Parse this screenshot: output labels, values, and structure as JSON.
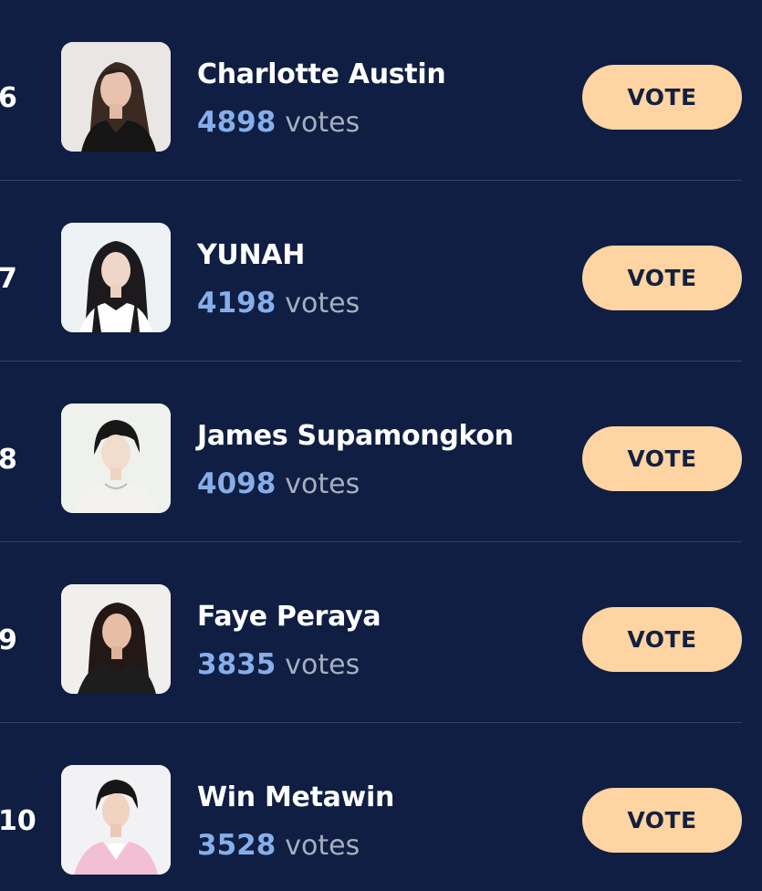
{
  "leaderboard": {
    "vote_button_label": "VOTE",
    "votes_label": "votes",
    "entries": [
      {
        "rank": "6",
        "name": "Charlotte Austin",
        "votes": "4898",
        "avatar_icon": "portrait-photo"
      },
      {
        "rank": "7",
        "name": "YUNAH",
        "votes": "4198",
        "avatar_icon": "portrait-photo"
      },
      {
        "rank": "8",
        "name": "James Supamongkon",
        "votes": "4098",
        "avatar_icon": "portrait-photo"
      },
      {
        "rank": "9",
        "name": "Faye Peraya",
        "votes": "3835",
        "avatar_icon": "portrait-photo"
      },
      {
        "rank": "10",
        "name": "Win Metawin",
        "votes": "3528",
        "avatar_icon": "portrait-photo"
      }
    ]
  },
  "colors": {
    "background": "#0f1e42",
    "vote_count": "#86aeea",
    "vote_button": "#fed4a2",
    "vote_button_text": "#14203f",
    "divider": "#33415f"
  }
}
